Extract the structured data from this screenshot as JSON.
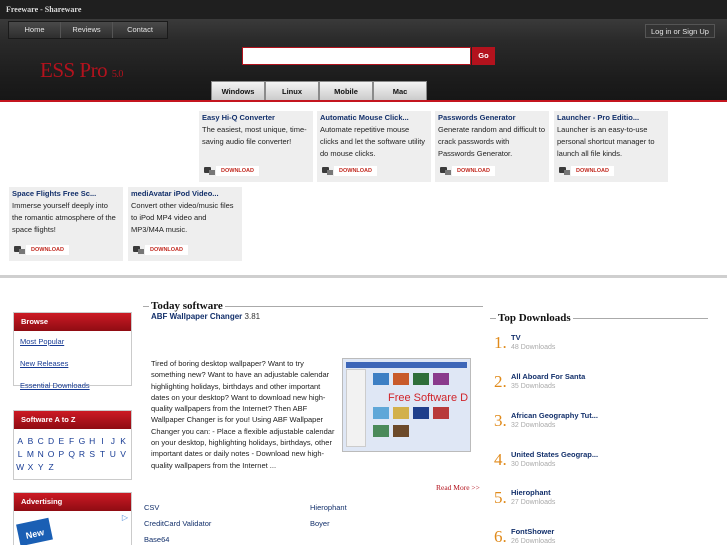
{
  "topbar": {
    "brand": "Freeware - Shareware"
  },
  "nav": {
    "items": [
      "Home",
      "Reviews",
      "Contact"
    ],
    "login": "Log in or Sign Up"
  },
  "logo": {
    "name": "ESS Pro",
    "version": "5.0"
  },
  "search": {
    "value": "",
    "button": "Go"
  },
  "os_tabs": [
    "Windows",
    "Linux",
    "Mobile",
    "Mac"
  ],
  "download_label": "DOWNLOAD",
  "featured": [
    {
      "title": "Easy Hi-Q Converter",
      "desc": "The easiest, most unique, time-saving audio file converter!"
    },
    {
      "title": "Automatic Mouse Click...",
      "desc": "Automate repetitive mouse clicks and let the software utility do mouse clicks."
    },
    {
      "title": "Passwords Generator",
      "desc": "Generate random and difficult to crack passwords with Passwords Generator."
    },
    {
      "title": "Launcher - Pro Editio...",
      "desc": "Launcher is an easy-to-use personal shortcut manager to launch all file kinds."
    },
    {
      "title": "Space Flights Free Sc...",
      "desc": "Immerse yourself deeply into the romantic atmosphere of the space flights!"
    },
    {
      "title": "mediAvatar iPod Video...",
      "desc": "Convert other video/music files to iPod MP4 video and MP3/M4A music."
    }
  ],
  "sidebar": {
    "browse": {
      "title": "Browse",
      "links": [
        "Most Popular",
        "New Releases",
        "Essential Downloads"
      ]
    },
    "az": {
      "title": "Software A to Z",
      "letters": [
        "A",
        "B",
        "C",
        "D",
        "E",
        "F",
        "G",
        "H",
        "I",
        "J",
        "K",
        "L",
        "M",
        "N",
        "O",
        "P",
        "Q",
        "R",
        "S",
        "T",
        "U",
        "V",
        "W",
        "X",
        "Y",
        "Z"
      ]
    },
    "ad": {
      "title": "Advertising",
      "badge": "New"
    }
  },
  "today": {
    "heading": "Today software",
    "name": "ABF Wallpaper Changer",
    "version": "3.81",
    "desc": "Tired of boring desktop wallpaper? Want to try something new? Want to have an adjustable calendar highlighting holidays, birthdays and other important dates on your desktop? Want to download new high-quality wallpapers from the Internet? Then ABF Wallpaper Changer is for you! Using ABF Wallpaper Changer you can: - Place a flexible adjustable calendar on your desktop, highlighting holidays, birthdays, other important dates or daily notes - Download new high-quality wallpapers from the Internet ...",
    "screenshot_text": "Free Software D",
    "read_more": "Read More >>",
    "list_left": [
      "CSV",
      "CreditCard Validator",
      "Base64"
    ],
    "list_right": [
      "Hierophant",
      "Boyer"
    ]
  },
  "top_downloads": {
    "heading": "Top Downloads",
    "items": [
      {
        "num": "1.",
        "name": "TV",
        "count": "48 Downloads"
      },
      {
        "num": "2.",
        "name": "All Aboard For Santa",
        "count": "35 Downloads"
      },
      {
        "num": "3.",
        "name": "African Geography Tut...",
        "count": "32 Downloads"
      },
      {
        "num": "4.",
        "name": "United States Geograp...",
        "count": "30 Downloads"
      },
      {
        "num": "5.",
        "name": "Hierophant",
        "count": "27 Downloads"
      },
      {
        "num": "6.",
        "name": "FontShower",
        "count": "26 Downloads"
      }
    ]
  }
}
